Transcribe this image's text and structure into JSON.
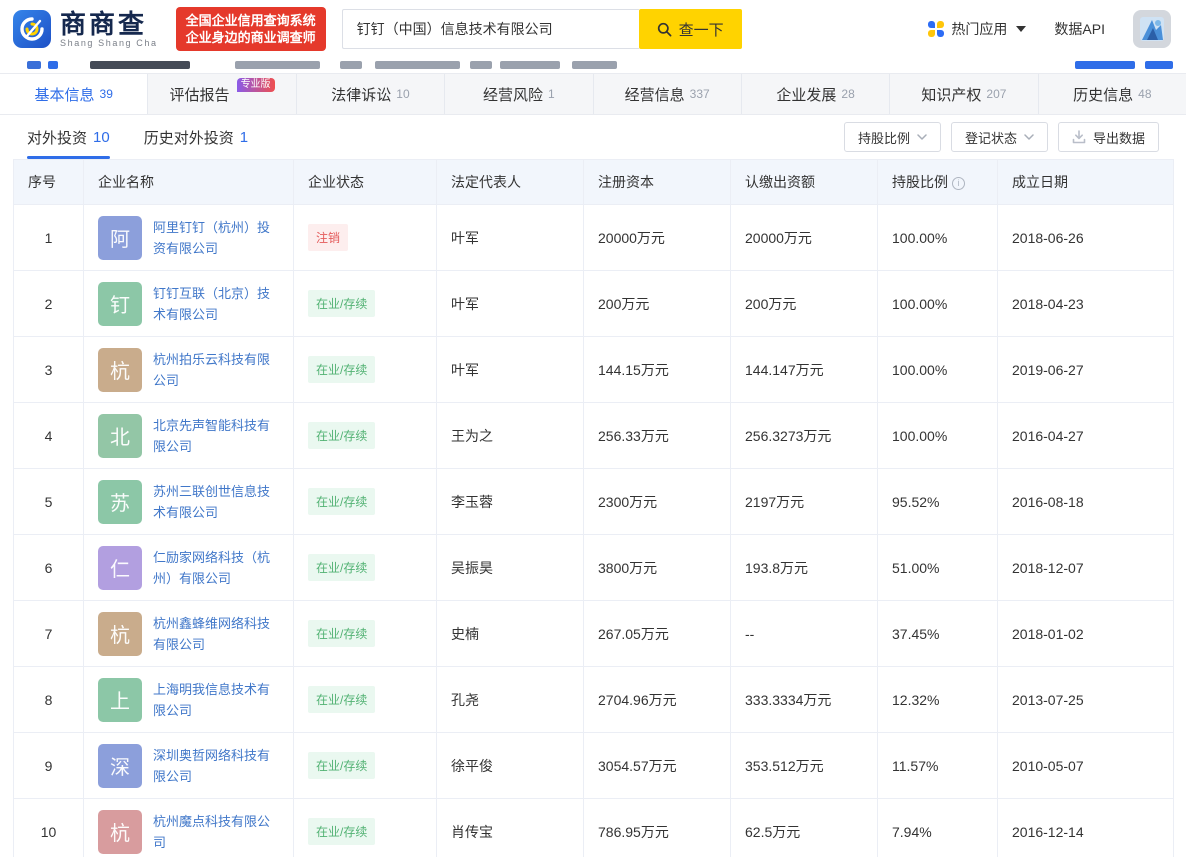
{
  "colors": {
    "accent_blue": "#2f6de8",
    "link_blue": "#4077c9",
    "brand_red": "#e5392b",
    "brand_yellow": "#ffd300",
    "status_active_text": "#52b273",
    "status_active_bg": "#eaf8f0",
    "status_cancelled_text": "#e45b5b",
    "status_cancelled_bg": "#fdeeee"
  },
  "header": {
    "logo_title": "商商查",
    "logo_subtitle": "Shang Shang Cha",
    "slogan_line1": "全国企业信用查询系统",
    "slogan_line2": "企业身边的商业调查师",
    "search_value": "钉钉（中国）信息技术有限公司",
    "search_button": "查一下",
    "hot_apps": "热门应用",
    "data_api": "数据API"
  },
  "tabs": [
    {
      "label": "基本信息",
      "count": "39",
      "active": true
    },
    {
      "label": "评估报告",
      "badge": "专业版"
    },
    {
      "label": "法律诉讼",
      "count": "10"
    },
    {
      "label": "经营风险",
      "count": "1"
    },
    {
      "label": "经营信息",
      "count": "337"
    },
    {
      "label": "企业发展",
      "count": "28"
    },
    {
      "label": "知识产权",
      "count": "207"
    },
    {
      "label": "历史信息",
      "count": "48"
    }
  ],
  "subtabs": [
    {
      "label": "对外投资",
      "count": "10",
      "active": true
    },
    {
      "label": "历史对外投资",
      "count": "1",
      "active": false
    }
  ],
  "toolbar": {
    "filters": [
      {
        "label": "持股比例"
      },
      {
        "label": "登记状态"
      }
    ],
    "export_label": "导出数据"
  },
  "table": {
    "columns": [
      "序号",
      "企业名称",
      "企业状态",
      "法定代表人",
      "注册资本",
      "认缴出资额",
      "持股比例",
      "成立日期"
    ],
    "rows": [
      {
        "no": "1",
        "avatar": "阿",
        "avatar_color": "#8c9fdb",
        "name": "阿里钉钉（杭州）投资有限公司",
        "status": "注销",
        "status_type": "cancelled",
        "legal_rep": "叶军",
        "reg_capital": "20000万元",
        "paid_capital": "20000万元",
        "ratio": "100.00%",
        "date": "2018-06-26"
      },
      {
        "no": "2",
        "avatar": "钉",
        "avatar_color": "#8cc7a7",
        "name": "钉钉互联（北京）技术有限公司",
        "status": "在业/存续",
        "status_type": "active",
        "legal_rep": "叶军",
        "reg_capital": "200万元",
        "paid_capital": "200万元",
        "ratio": "100.00%",
        "date": "2018-04-23"
      },
      {
        "no": "3",
        "avatar": "杭",
        "avatar_color": "#c9ac8c",
        "name": "杭州拍乐云科技有限公司",
        "status": "在业/存续",
        "status_type": "active",
        "legal_rep": "叶军",
        "reg_capital": "144.15万元",
        "paid_capital": "144.147万元",
        "ratio": "100.00%",
        "date": "2019-06-27"
      },
      {
        "no": "4",
        "avatar": "北",
        "avatar_color": "#93c6a6",
        "name": "北京先声智能科技有限公司",
        "status": "在业/存续",
        "status_type": "active",
        "legal_rep": "王为之",
        "reg_capital": "256.33万元",
        "paid_capital": "256.3273万元",
        "ratio": "100.00%",
        "date": "2016-04-27"
      },
      {
        "no": "5",
        "avatar": "苏",
        "avatar_color": "#8cc7a7",
        "name": "苏州三联创世信息技术有限公司",
        "status": "在业/存续",
        "status_type": "active",
        "legal_rep": "李玉蓉",
        "reg_capital": "2300万元",
        "paid_capital": "2197万元",
        "ratio": "95.52%",
        "date": "2016-08-18"
      },
      {
        "no": "6",
        "avatar": "仁",
        "avatar_color": "#b29fe0",
        "name": "仁励家网络科技（杭州）有限公司",
        "status": "在业/存续",
        "status_type": "active",
        "legal_rep": "吴振昊",
        "reg_capital": "3800万元",
        "paid_capital": "193.8万元",
        "ratio": "51.00%",
        "date": "2018-12-07"
      },
      {
        "no": "7",
        "avatar": "杭",
        "avatar_color": "#c9ac8c",
        "name": "杭州鑫蜂维网络科技有限公司",
        "status": "在业/存续",
        "status_type": "active",
        "legal_rep": "史楠",
        "reg_capital": "267.05万元",
        "paid_capital": "--",
        "ratio": "37.45%",
        "date": "2018-01-02"
      },
      {
        "no": "8",
        "avatar": "上",
        "avatar_color": "#8cc7a7",
        "name": "上海明我信息技术有限公司",
        "status": "在业/存续",
        "status_type": "active",
        "legal_rep": "孔尧",
        "reg_capital": "2704.96万元",
        "paid_capital": "333.3334万元",
        "ratio": "12.32%",
        "date": "2013-07-25"
      },
      {
        "no": "9",
        "avatar": "深",
        "avatar_color": "#8c9fdb",
        "name": "深圳奥哲网络科技有限公司",
        "status": "在业/存续",
        "status_type": "active",
        "legal_rep": "徐平俊",
        "reg_capital": "3054.57万元",
        "paid_capital": "353.512万元",
        "ratio": "11.57%",
        "date": "2010-05-07"
      },
      {
        "no": "10",
        "avatar": "杭",
        "avatar_color": "#d89c9e",
        "name": "杭州魔点科技有限公司",
        "status": "在业/存续",
        "status_type": "active",
        "legal_rep": "肖传宝",
        "reg_capital": "786.95万元",
        "paid_capital": "62.5万元",
        "ratio": "7.94%",
        "date": "2016-12-14"
      }
    ]
  }
}
